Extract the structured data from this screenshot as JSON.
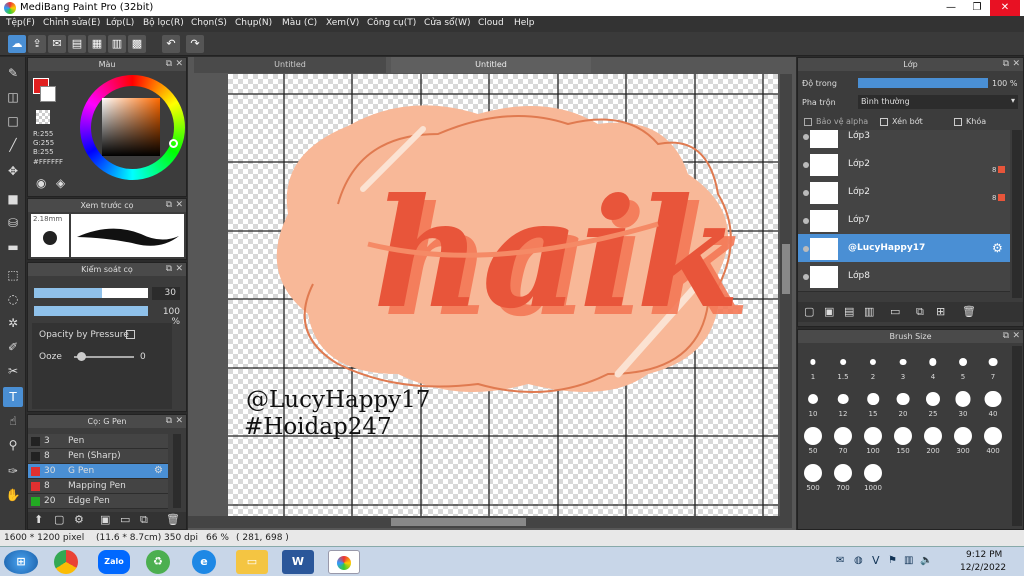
{
  "window": {
    "title": "MediBang Paint Pro (32bit)",
    "minimize": "—",
    "maximize": "❐",
    "close": "✕"
  },
  "menu": [
    "Tệp(F)",
    "Chỉnh sửa(E)",
    "Lớp(L)",
    "Bộ lọc(R)",
    "Chọn(S)",
    "Chụp(N)",
    "Màu (C)",
    "Xem(V)",
    "Công cụ(T)",
    "Cửa sổ(W)",
    "Cloud",
    "Help"
  ],
  "color_panel": {
    "title": "Màu",
    "r": "R:255",
    "g": "G:255",
    "b": "B:255",
    "hex": "#FFFFFF"
  },
  "preview_panel": {
    "title": "Xem trước cọ",
    "size": "2.18mm"
  },
  "control_panel": {
    "title": "Kiểm soát cọ",
    "size_value": "30",
    "size_fraction": 0.6,
    "opacity_value": "100 %",
    "opacity_fraction": 1.0,
    "opacity_pressure": "Opacity by Pressure",
    "ooze_label": "Ooze",
    "ooze_value": "0"
  },
  "brush_panel": {
    "title": "Cọ: G Pen",
    "brushes": [
      {
        "size": "3",
        "name": "Pen",
        "color": "#222222",
        "active": false
      },
      {
        "size": "8",
        "name": "Pen (Sharp)",
        "color": "#222222",
        "active": false
      },
      {
        "size": "30",
        "name": "G Pen",
        "color": "#e03030",
        "active": true
      },
      {
        "size": "8",
        "name": "Mapping Pen",
        "color": "#e03030",
        "active": false
      },
      {
        "size": "20",
        "name": "Edge Pen",
        "color": "#22aa22",
        "active": false
      }
    ]
  },
  "document_tabs": [
    {
      "label": "Untitled",
      "active": false
    },
    {
      "label": "Untitled",
      "active": true
    }
  ],
  "artwork": {
    "word": "haik",
    "watermark_line1": "@LucyHappy17",
    "watermark_line2": "#Hoidap247"
  },
  "layer_panel": {
    "title": "Lớp",
    "opacity_label": "Độ trong",
    "opacity_value": "100 %",
    "opacity_fraction": 1.0,
    "blend_label": "Pha trộn",
    "blend_value": "Bình thường",
    "protect_alpha": "Bảo vệ alpha",
    "clipping": "Xén bớt",
    "lock": "Khóa",
    "layers": [
      {
        "name": "Lớp3",
        "active": false,
        "badge": ""
      },
      {
        "name": "Lớp2",
        "active": false,
        "badge": "8"
      },
      {
        "name": "Lớp2",
        "active": false,
        "badge": "8"
      },
      {
        "name": "Lớp7",
        "active": false,
        "badge": ""
      },
      {
        "name": "@LucyHappy17",
        "active": true,
        "badge": ""
      },
      {
        "name": "Lớp8",
        "active": false,
        "badge": ""
      }
    ]
  },
  "brush_size_panel": {
    "title": "Brush Size",
    "sizes": [
      "1",
      "1.5",
      "2",
      "3",
      "4",
      "5",
      "7",
      "10",
      "12",
      "15",
      "20",
      "25",
      "30",
      "40",
      "50",
      "70",
      "100",
      "150",
      "200",
      "300",
      "400",
      "500",
      "700",
      "1000"
    ]
  },
  "status": {
    "dimensions": "1600 * 1200 pixel",
    "physical": "(11.6 * 8.7cm)",
    "dpi": "350 dpi",
    "zoom": "66 %",
    "coords": "( 281, 698 )"
  },
  "taskbar": {
    "time": "9:12 PM",
    "date": "12/2/2022",
    "tray_letter": "V"
  },
  "colors": {
    "accent": "#4a8fd4",
    "blob": "#f8b898",
    "lettering": "#e8553a"
  }
}
